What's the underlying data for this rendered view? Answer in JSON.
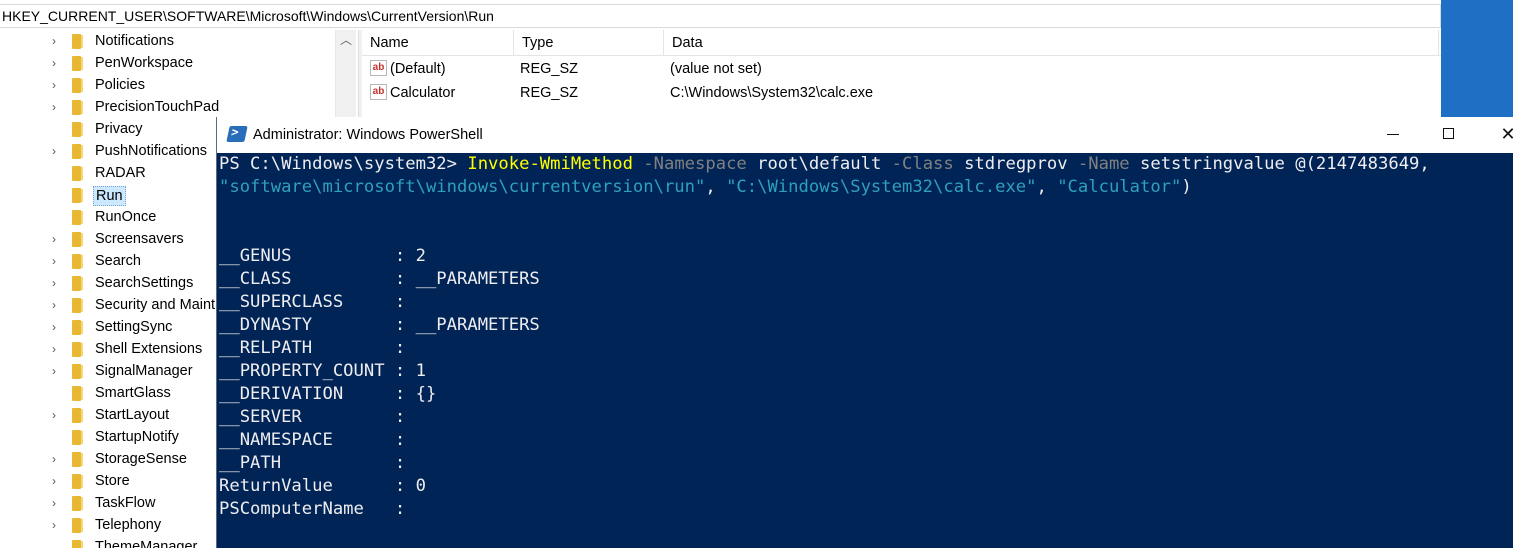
{
  "registry": {
    "address": "HKEY_CURRENT_USER\\SOFTWARE\\Microsoft\\Windows\\CurrentVersion\\Run",
    "tree_items": [
      {
        "label": "Notifications",
        "expandable": true
      },
      {
        "label": "PenWorkspace",
        "expandable": true
      },
      {
        "label": "Policies",
        "expandable": true
      },
      {
        "label": "PrecisionTouchPad",
        "expandable": true
      },
      {
        "label": "Privacy",
        "expandable": false
      },
      {
        "label": "PushNotifications",
        "expandable": true
      },
      {
        "label": "RADAR",
        "expandable": false
      },
      {
        "label": "Run",
        "expandable": false,
        "selected": true
      },
      {
        "label": "RunOnce",
        "expandable": false
      },
      {
        "label": "Screensavers",
        "expandable": true
      },
      {
        "label": "Search",
        "expandable": true
      },
      {
        "label": "SearchSettings",
        "expandable": true
      },
      {
        "label": "Security and Maint",
        "expandable": true
      },
      {
        "label": "SettingSync",
        "expandable": true
      },
      {
        "label": "Shell Extensions",
        "expandable": true
      },
      {
        "label": "SignalManager",
        "expandable": true
      },
      {
        "label": "SmartGlass",
        "expandable": false
      },
      {
        "label": "StartLayout",
        "expandable": true
      },
      {
        "label": "StartupNotify",
        "expandable": false
      },
      {
        "label": "StorageSense",
        "expandable": true
      },
      {
        "label": "Store",
        "expandable": true
      },
      {
        "label": "TaskFlow",
        "expandable": true
      },
      {
        "label": "Telephony",
        "expandable": true
      },
      {
        "label": "ThemeManager",
        "expandable": false
      }
    ],
    "columns": {
      "name": "Name",
      "type": "Type",
      "data": "Data"
    },
    "values": [
      {
        "name": "(Default)",
        "type": "REG_SZ",
        "data": "(value not set)",
        "icon": "ab"
      },
      {
        "name": "Calculator",
        "type": "REG_SZ",
        "data": "C:\\Windows\\System32\\calc.exe",
        "icon": "ab"
      }
    ]
  },
  "powershell": {
    "title": "Administrator: Windows PowerShell",
    "command": {
      "prompt": "PS C:\\Windows\\system32> ",
      "cmdlet": "Invoke-WmiMethod",
      "param1": " -Namespace",
      "arg1": " root\\default",
      "param2": " -Class",
      "arg2": " stdregprov",
      "param3": " -Name",
      "arg3": " setstringvalue @(2147483649,",
      "line2_str1": "\"software\\microsoft\\windows\\currentversion\\run\"",
      "line2_sep1": ", ",
      "line2_str2": "\"C:\\Windows\\System32\\calc.exe\"",
      "line2_sep2": ", ",
      "line2_str3": "\"Calculator\"",
      "line2_end": ")"
    },
    "output": [
      "__GENUS          : 2",
      "__CLASS          : __PARAMETERS",
      "__SUPERCLASS     :",
      "__DYNASTY        : __PARAMETERS",
      "__RELPATH        :",
      "__PROPERTY_COUNT : 1",
      "__DERIVATION     : {}",
      "__SERVER         :",
      "__NAMESPACE      :",
      "__PATH           :",
      "ReturnValue      : 0",
      "PSComputerName   :"
    ],
    "colors": {
      "background": "#012456",
      "cmdlet": "#ffff00",
      "parameter": "#808080",
      "string": "#2fa0ba",
      "text": "#eeedf0"
    }
  }
}
